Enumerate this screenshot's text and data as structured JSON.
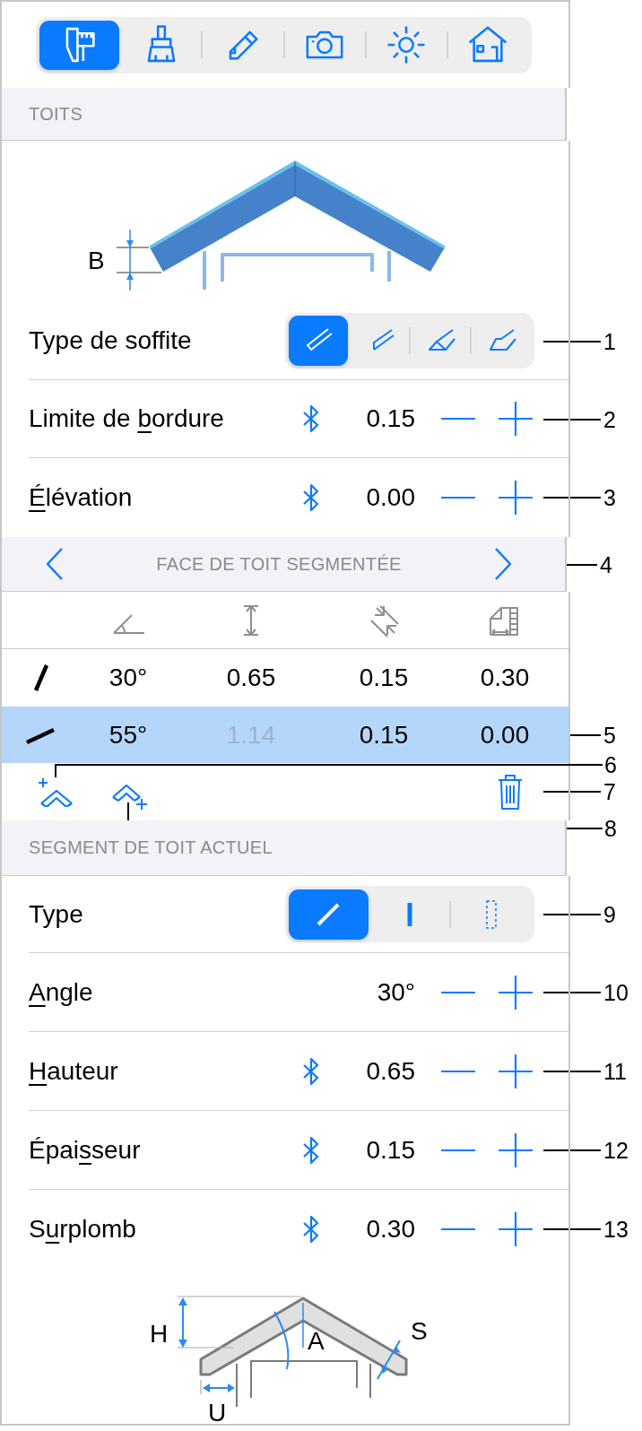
{
  "toolbar": [
    {
      "kind": "caliper",
      "selected": true
    },
    {
      "kind": "brush",
      "selected": false
    },
    {
      "kind": "pencil",
      "selected": false
    },
    {
      "kind": "camera",
      "selected": false
    },
    {
      "kind": "sun",
      "selected": false
    },
    {
      "kind": "house",
      "selected": false
    }
  ],
  "roofs": {
    "header": "TOITS",
    "diagram": {
      "label": "B"
    },
    "soffit": {
      "label": "Type de soffite",
      "callout": "1",
      "options": [
        {
          "kind": "plain",
          "selected": true
        },
        {
          "kind": "angled",
          "selected": false
        },
        {
          "kind": "boxed",
          "selected": false
        },
        {
          "kind": "stepped",
          "selected": false
        }
      ]
    },
    "fields": [
      {
        "label": {
          "pre": "Limite de ",
          "key": "b",
          "post": "ordure"
        },
        "linked": true,
        "value": "0.15",
        "callout": "2"
      },
      {
        "label": {
          "key": "É",
          "post": "lévation"
        },
        "linked": true,
        "value": "0.00",
        "callout": "3"
      }
    ]
  },
  "face": {
    "title": "FACE DE TOIT SEGMENTÉE",
    "callout": "4",
    "columns": [
      {
        "kind": "angle"
      },
      {
        "kind": "height"
      },
      {
        "kind": "thickness"
      },
      {
        "kind": "overhang"
      }
    ],
    "rows": [
      {
        "kind": "steep",
        "selected": false,
        "cells": [
          {
            "text": "30°",
            "dim": false
          },
          {
            "text": "0.65",
            "dim": false
          },
          {
            "text": "0.15",
            "dim": false
          },
          {
            "text": "0.30",
            "dim": false
          }
        ]
      },
      {
        "kind": "shallow",
        "selected": true,
        "callout": "5",
        "cells": [
          {
            "text": "55°",
            "dim": false
          },
          {
            "text": "1.14",
            "dim": true
          },
          {
            "text": "0.15",
            "dim": false
          },
          {
            "text": "0.00",
            "dim": false
          }
        ]
      }
    ],
    "actions": [
      {
        "kind": "add-before"
      },
      {
        "kind": "add-after"
      },
      {
        "kind": "delete"
      }
    ],
    "action_callouts": [
      {
        "kind": "up",
        "text": "6"
      },
      {
        "kind": "level",
        "text": "7"
      },
      {
        "kind": "down",
        "text": "8"
      }
    ]
  },
  "segment": {
    "header": "SEGMENT DE TOIT ACTUEL",
    "type": {
      "label": "Type",
      "callout": "9",
      "options": [
        {
          "kind": "slope",
          "selected": true
        },
        {
          "kind": "wall",
          "selected": false
        },
        {
          "kind": "gap",
          "selected": false
        }
      ]
    },
    "fields": [
      {
        "label": {
          "key": "A",
          "post": "ngle"
        },
        "linked": false,
        "value": "30°",
        "callout": "10"
      },
      {
        "label": {
          "key": "H",
          "post": "auteur"
        },
        "linked": true,
        "value": "0.65",
        "callout": "11"
      },
      {
        "label": {
          "pre": "Épai",
          "key": "s",
          "post": "seur"
        },
        "linked": true,
        "value": "0.15",
        "callout": "12"
      },
      {
        "label": {
          "pre": "S",
          "key": "u",
          "post": "rplomb"
        },
        "linked": true,
        "value": "0.30",
        "callout": "13"
      }
    ],
    "diagram": {
      "labels": [
        {
          "kind": "height",
          "text": "H"
        },
        {
          "kind": "angle",
          "text": "A"
        },
        {
          "kind": "thickness",
          "text": "S"
        },
        {
          "kind": "overhang",
          "text": "U"
        }
      ]
    }
  }
}
